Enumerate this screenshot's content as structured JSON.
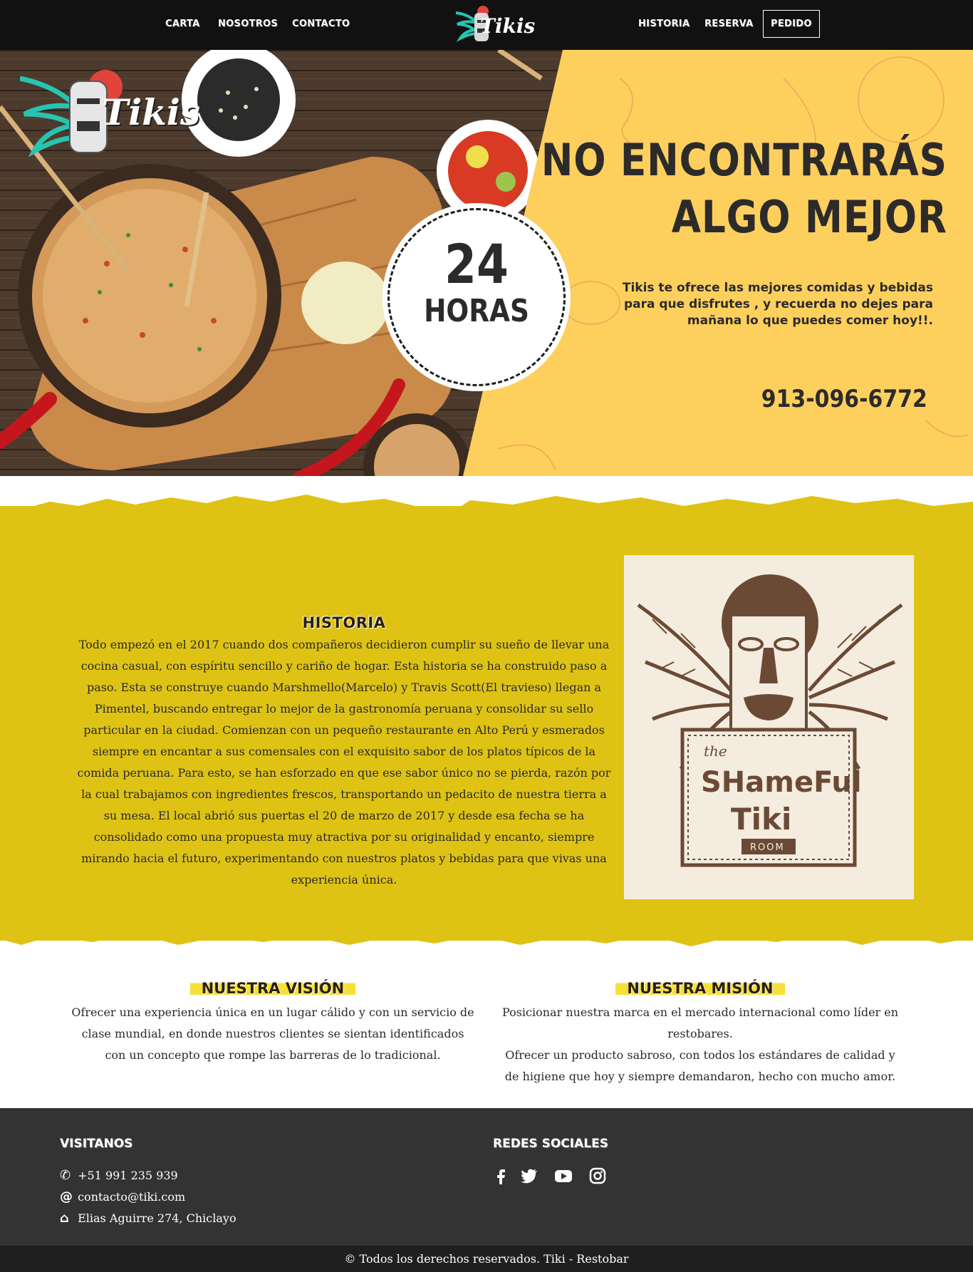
{
  "nav": {
    "left": [
      "CARTA",
      "NOSOTROS",
      "CONTACTO"
    ],
    "right": [
      "HISTORIA",
      "RESERVA"
    ],
    "cta": "PEDIDO",
    "logo_text": "Tikis"
  },
  "hero": {
    "logo_text": "Tikis",
    "headline_line1": "NO ENCONTRARÁS",
    "headline_line2": "ALGO MEJOR",
    "badge_number": "24",
    "badge_label": "HORAS",
    "blurb": "Tikis te ofrece las mejores comidas y bebidas para que disfrutes , y recuerda no dejes para mañana lo que puedes comer hoy!!.",
    "phone": "913-096-6772",
    "accent_color": "#fdd05e"
  },
  "historia": {
    "title": "HISTORIA",
    "body": "Todo empezó en el 2017 cuando dos compañeros decidieron cumplir su sueño de llevar una cocina casual, con espíritu sencillo y cariño de hogar. Esta historia se ha construido paso a paso. Esta se construye cuando Marshmello(Marcelo) y Travis Scott(El travieso) llegan a Pimentel, buscando entregar lo mejor de la gastronomía peruana y consolidar su sello particular en la ciudad. Comienzan con un pequeño restaurante en Alto Perú y esmerados siempre en encantar a sus comensales con el exquisito sabor de los platos típicos de la comida peruana. Para esto, se han esforzado en que ese sabor único no se pierda, razón por la cual trabajamos con ingredientes frescos, transportando un pedacito de nuestra tierra a su mesa. El local abrió sus puertas el 20 de marzo de 2017 y desde esa fecha se ha consolidado como una propuesta muy atractiva por su originalidad y encanto, siempre mirando hacia el futuro, experimentando con nuestros platos y bebidas para que vivas una experiencia única.",
    "image_words": [
      "the",
      "SHameFul",
      "Tiki",
      "ROOM"
    ],
    "background_color": "#dfc314"
  },
  "vision": {
    "title": "NUESTRA VISIÓN",
    "text": "Ofrecer una experiencia única en un lugar cálido y con un servicio de clase mundial, en donde nuestros clientes se sientan identificados con un concepto que rompe las barreras de lo tradicional."
  },
  "mision": {
    "title": "NUESTRA MISIÓN",
    "line1": "Posicionar nuestra marca en el mercado internacional como líder en restobares.",
    "line2": "Ofrecer un producto sabroso, con todos los estándares de calidad y de higiene que hoy y siempre demandaron, hecho con mucho amor."
  },
  "footer": {
    "visit_title": "VISITANOS",
    "phone": "+51 991 235 939",
    "email": "contacto@tiki.com",
    "address": "Elias Aguirre 274, Chiclayo",
    "social_title": "REDES SOCIALES",
    "social_icons": [
      "facebook-icon",
      "twitter-icon",
      "youtube-icon",
      "instagram-icon"
    ],
    "copyright": "© Todos los derechos reservados. Tiki - Restobar"
  }
}
